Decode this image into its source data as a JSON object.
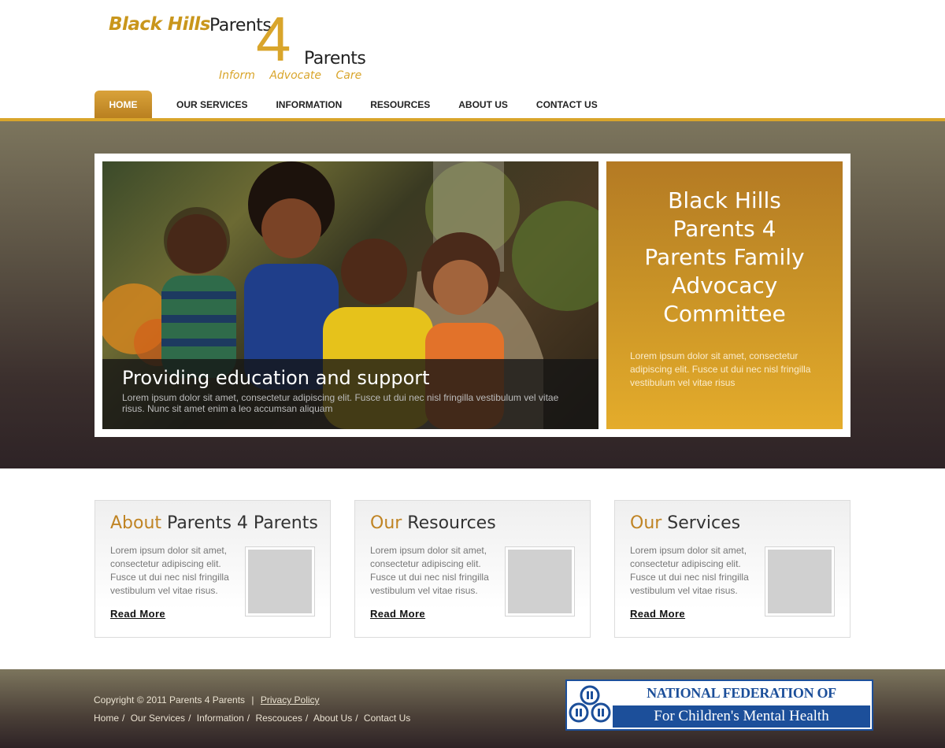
{
  "logo": {
    "black_hills": "Black Hills",
    "parents_1": "Parents",
    "four": "4",
    "parents_2": "Parents",
    "tagline": "Inform Advocate Care"
  },
  "nav": {
    "items": [
      "HOME",
      "OUR SERVICES",
      "INFORMATION",
      "RESOURCES",
      "ABOUT US",
      "CONTACT US"
    ],
    "active_index": 0
  },
  "hero": {
    "caption_title": "Providing education and support",
    "caption_text": "Lorem ipsum dolor sit amet, consectetur adipiscing elit. Fusce ut dui nec nisl fringilla vestibulum vel vitae risus. Nunc sit amet enim a leo accumsan aliquam",
    "side_title": "Black Hills Parents 4 Parents Family Advocacy Committee",
    "side_text": "Lorem ipsum dolor sit amet, consectetur adipiscing elit. Fusce ut dui nec nisl fringilla vestibulum vel vitae risus"
  },
  "boxes": [
    {
      "title_highlight": "About",
      "title_rest": " Parents 4 Parents",
      "text": "Lorem ipsum dolor sit amet, consectetur adipiscing elit. Fusce ut dui nec nisl fringilla vestibulum vel vitae risus.",
      "read_more": "Read More"
    },
    {
      "title_highlight": "Our",
      "title_rest": " Resources",
      "text": "Lorem ipsum dolor sit amet, consectetur adipiscing elit. Fusce ut dui nec nisl fringilla vestibulum vel vitae risus.",
      "read_more": "Read More"
    },
    {
      "title_highlight": "Our",
      "title_rest": " Services",
      "text": "Lorem ipsum dolor sit amet, consectetur adipiscing elit. Fusce ut dui nec nisl fringilla vestibulum vel vitae risus.",
      "read_more": "Read More"
    }
  ],
  "footer": {
    "copyright": "Copyright © 2011 Parents 4 Parents",
    "divider": "|",
    "privacy": "Privacy Policy",
    "links": [
      "Home",
      "Our Services",
      "Information",
      "Rescouces",
      "About Us",
      "Contact Us"
    ],
    "nff_top": "NATIONAL FEDERATION OF FAMILIES",
    "nff_bottom": "For Children's Mental Health"
  },
  "colors": {
    "accent": "#d9a52b",
    "title_highlight": "#c08424",
    "nff_blue": "#1c4f9a"
  }
}
